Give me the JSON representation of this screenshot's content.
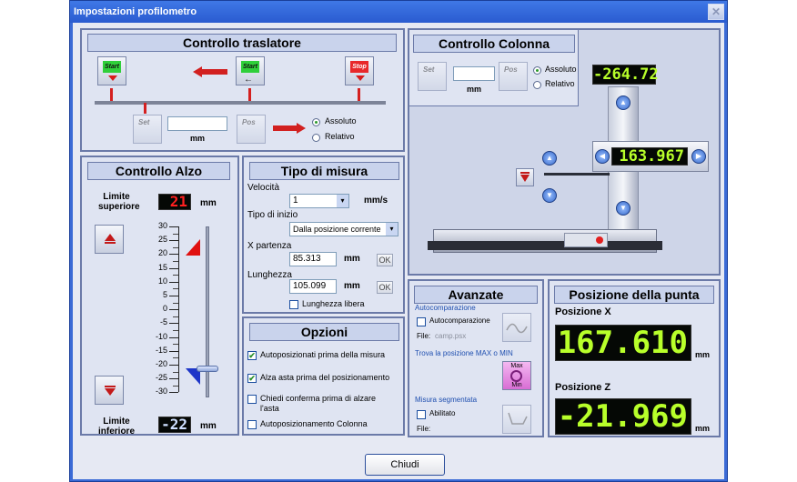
{
  "window": {
    "title": "Impostazioni profilometro",
    "close_glyph": "✕"
  },
  "traslatore": {
    "title": "Controllo traslatore",
    "start_label": "Start",
    "stop_label": "Stop",
    "set_label": "Set",
    "pos_label": "Pos",
    "value": "",
    "unit": "mm",
    "radio_abs": "Assoluto",
    "radio_rel": "Relativo"
  },
  "colonna": {
    "title": "Controllo Colonna",
    "set_label": "Set",
    "pos_label": "Pos",
    "value": "",
    "unit": "mm",
    "radio_abs": "Assoluto",
    "radio_rel": "Relativo",
    "display_top": "-264.72",
    "display_mid": "163.967"
  },
  "alzo": {
    "title": "Controllo Alzo",
    "limit_upper_label": "Limite superiore",
    "limit_upper_value": "21",
    "limit_lower_label": "Limite inferiore",
    "limit_lower_value": "-22",
    "unit": "mm",
    "ticks": [
      "30",
      "25",
      "20",
      "15",
      "10",
      "5",
      "0",
      "-5",
      "-10",
      "-15",
      "-20",
      "-25",
      "-30"
    ]
  },
  "tipo": {
    "title": "Tipo di misura",
    "velocita_label": "Velocità",
    "velocita_value": "1",
    "velocita_unit": "mm/s",
    "tipo_inizio_label": "Tipo di inizio",
    "tipo_inizio_value": "Dalla posizione corrente",
    "xpartenza_label": "X partenza",
    "xpartenza_value": "85.313",
    "xpartenza_unit": "mm",
    "ok_label": "OK",
    "lunghezza_label": "Lunghezza",
    "lunghezza_value": "105.099",
    "lunghezza_unit": "mm",
    "lunghezza_libera": "Lunghezza libera"
  },
  "opzioni": {
    "title": "Opzioni",
    "items": [
      {
        "label": "Autoposizionati prima della misura",
        "checked": "✔"
      },
      {
        "label": "Alza asta prima del posizionamento",
        "checked": "✔"
      },
      {
        "label": "Chiedi conferma prima di alzare l'asta",
        "checked": ""
      },
      {
        "label": "Autoposizionamento Colonna",
        "checked": ""
      }
    ]
  },
  "avanzate": {
    "title": "Avanzate",
    "autocomp_group": "Autocomparazione",
    "autocomp_check": "Autocomparazione",
    "file_label": "File:",
    "file_value": "camp.psx",
    "maxmin_group": "Trova la posizione MAX o MIN",
    "max_label": "Max",
    "min_label": "Min",
    "seg_group": "Misura segmentata",
    "seg_check": "Abilitato",
    "seg_file_label": "File:"
  },
  "punta": {
    "title": "Posizione della punta",
    "x_label": "Posizione X",
    "x_value": "167.610",
    "z_label": "Posizione Z",
    "z_value": "-21.969",
    "unit": "mm"
  },
  "close_button": "Chiudi"
}
